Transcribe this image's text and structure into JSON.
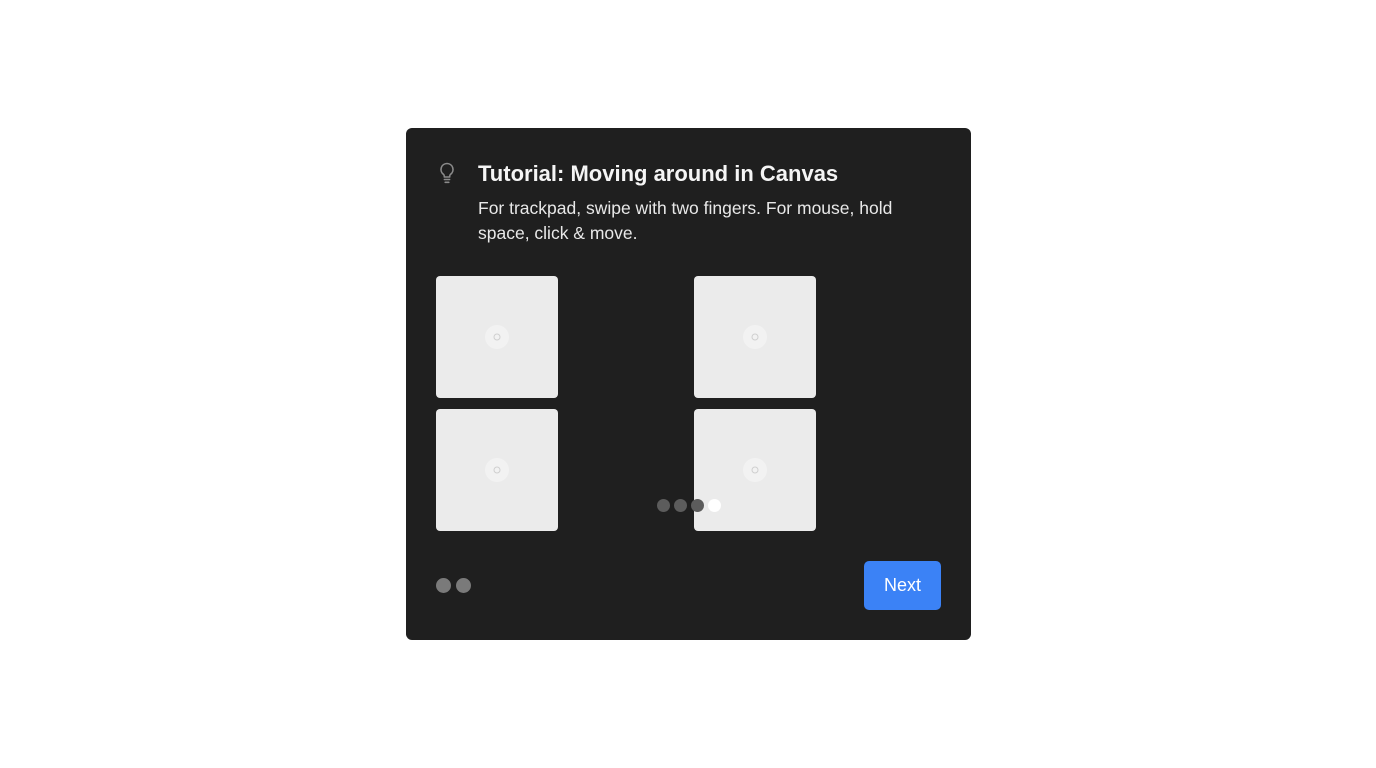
{
  "dialog": {
    "icon": "lightbulb-icon",
    "title": "Tutorial: Moving around in Canvas",
    "description": "For trackpad, swipe with two fingers. For mouse, hold space, click & move.",
    "tiles": [
      {
        "icon": "loading-spinner-icon"
      },
      {
        "icon": "loading-spinner-icon"
      },
      {
        "icon": "loading-spinner-icon"
      },
      {
        "icon": "loading-spinner-icon"
      }
    ],
    "carousel": {
      "total": 4,
      "active_index": 3
    },
    "steps": {
      "total": 2
    },
    "next_label": "Next"
  },
  "colors": {
    "dialog_background": "#1f1f1f",
    "primary_button": "#3b82f6",
    "tile_background": "#ebebeb",
    "dot_inactive": "#5c5c5c",
    "dot_active": "#ffffff"
  }
}
